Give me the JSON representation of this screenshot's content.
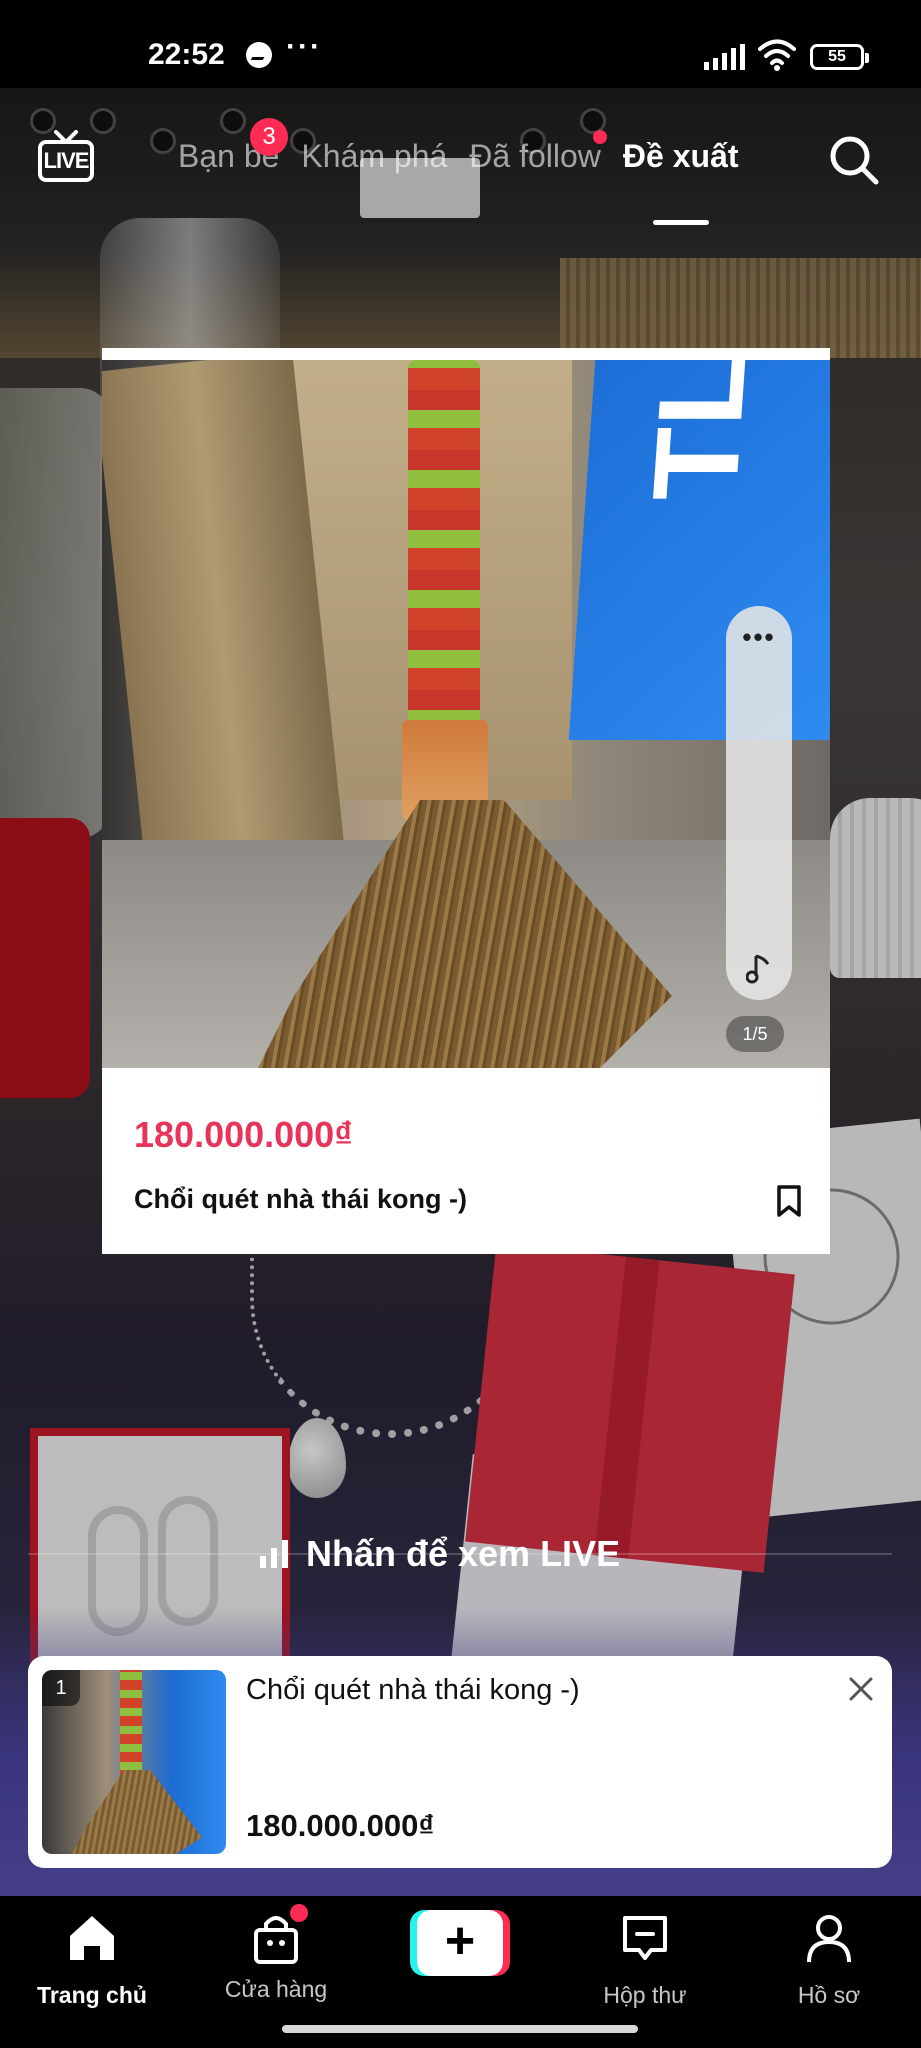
{
  "status_bar": {
    "time": "22:52",
    "messenger_icon": "messenger-icon",
    "more_dots": "···",
    "battery": "55"
  },
  "top_nav": {
    "live_label": "LIVE",
    "tabs": [
      {
        "label": "Bạn bè",
        "badge": "3"
      },
      {
        "label": "Khám phá"
      },
      {
        "label": "Đã follow",
        "has_dot": true
      },
      {
        "label": "Đề xuất",
        "active": true
      }
    ]
  },
  "product_card": {
    "more_label": "•••",
    "page_indicator": "1/5",
    "price": "180.000.000₫",
    "title": "Chổi quét nhà thái kong -)"
  },
  "live_caption": "Nhấn để xem LIVE",
  "popup": {
    "rank": "1",
    "title": "Chổi quét nhà thái kong -)",
    "price": "180.000.000₫"
  },
  "bottom_nav": {
    "items": [
      {
        "label": "Trang chủ",
        "icon": "home-icon",
        "active": true
      },
      {
        "label": "Cửa hàng",
        "icon": "shopping-bag-icon",
        "has_dot": true
      },
      {
        "label": "+",
        "icon": "create-icon"
      },
      {
        "label": "Hộp thư",
        "icon": "inbox-icon"
      },
      {
        "label": "Hồ sơ",
        "icon": "profile-icon"
      }
    ]
  },
  "colors": {
    "accent": "#fe2c55",
    "price": "#e8335b",
    "cyan": "#25f4ee"
  }
}
